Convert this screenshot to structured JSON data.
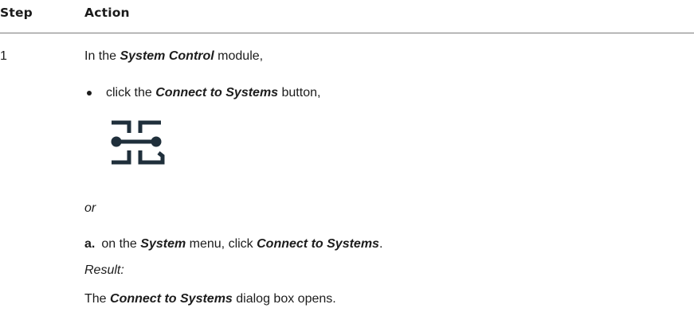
{
  "table": {
    "headers": {
      "step": "Step",
      "action": "Action"
    }
  },
  "step1": {
    "number": "1",
    "intro": {
      "pre": "In the ",
      "bold": "System Control",
      "post": " module,"
    },
    "bullet": {
      "pre": "click the ",
      "bold": "Connect to Systems",
      "post": " button,"
    },
    "icon": "connect-to-systems-icon",
    "or_text": "or",
    "alt": {
      "label": "a.",
      "pre": "on the ",
      "bold1": "System",
      "mid": " menu, click ",
      "bold2": "Connect to Systems",
      "post": "."
    },
    "result_label": "Result:",
    "result": {
      "pre": "The ",
      "bold": "Connect to Systems",
      "post": " dialog box opens."
    }
  },
  "colors": {
    "icon": "#1f2f3b",
    "text": "#1c1c1c",
    "rule": "#7a7a7a"
  }
}
